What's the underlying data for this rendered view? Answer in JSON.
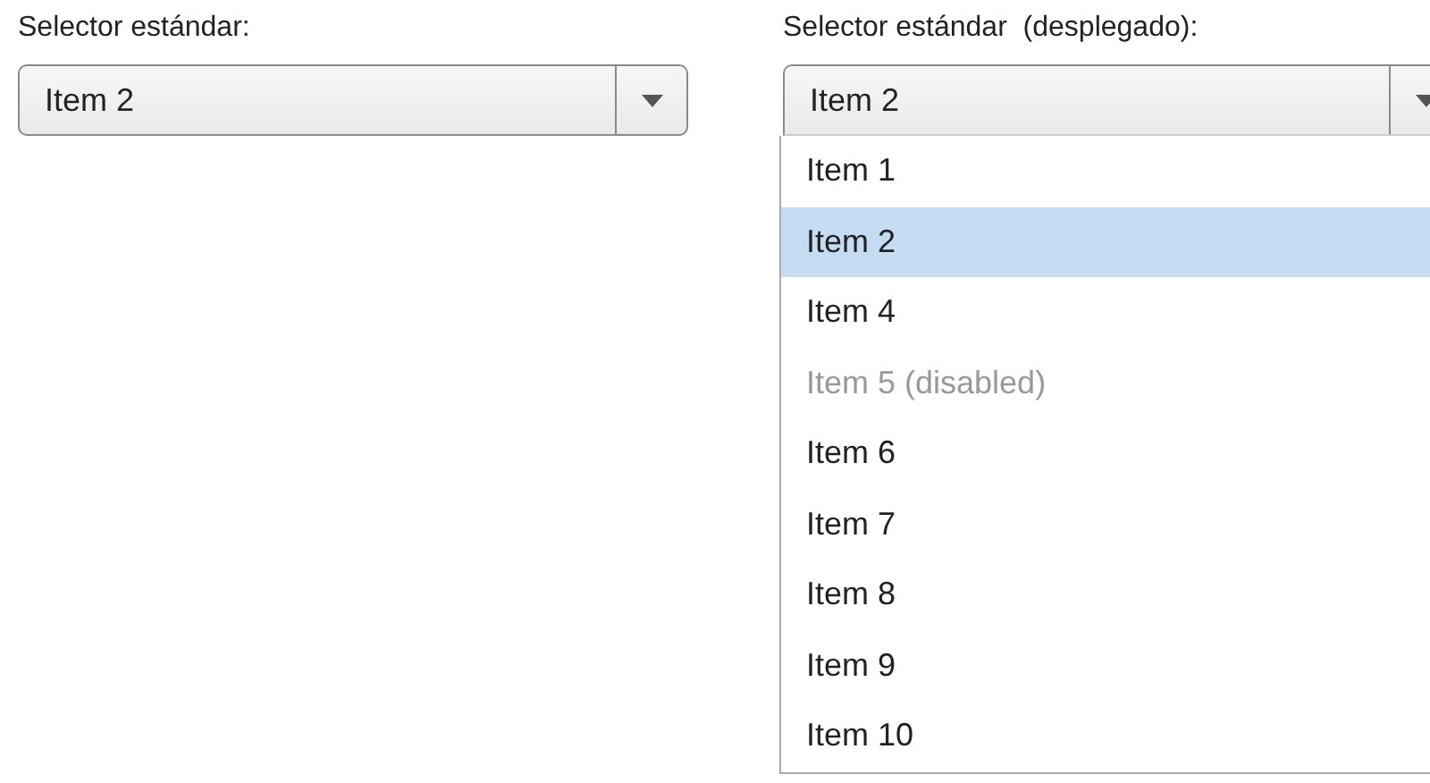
{
  "selectors": [
    {
      "label": "Selector estándar:",
      "value": "Item 2",
      "expanded": false
    },
    {
      "label": "Selector estándar  (desplegado):",
      "value": "Item 2",
      "expanded": true,
      "options": [
        {
          "text": "Item 1",
          "selected": false,
          "disabled": false
        },
        {
          "text": "Item 2",
          "selected": true,
          "disabled": false
        },
        {
          "text": "Item 4",
          "selected": false,
          "disabled": false
        },
        {
          "text": "Item 5 (disabled)",
          "selected": false,
          "disabled": true
        },
        {
          "text": "Item 6",
          "selected": false,
          "disabled": false
        },
        {
          "text": "Item 7",
          "selected": false,
          "disabled": false
        },
        {
          "text": "Item 8",
          "selected": false,
          "disabled": false
        },
        {
          "text": "Item 9",
          "selected": false,
          "disabled": false
        },
        {
          "text": "Item 10",
          "selected": false,
          "disabled": false
        }
      ]
    }
  ]
}
